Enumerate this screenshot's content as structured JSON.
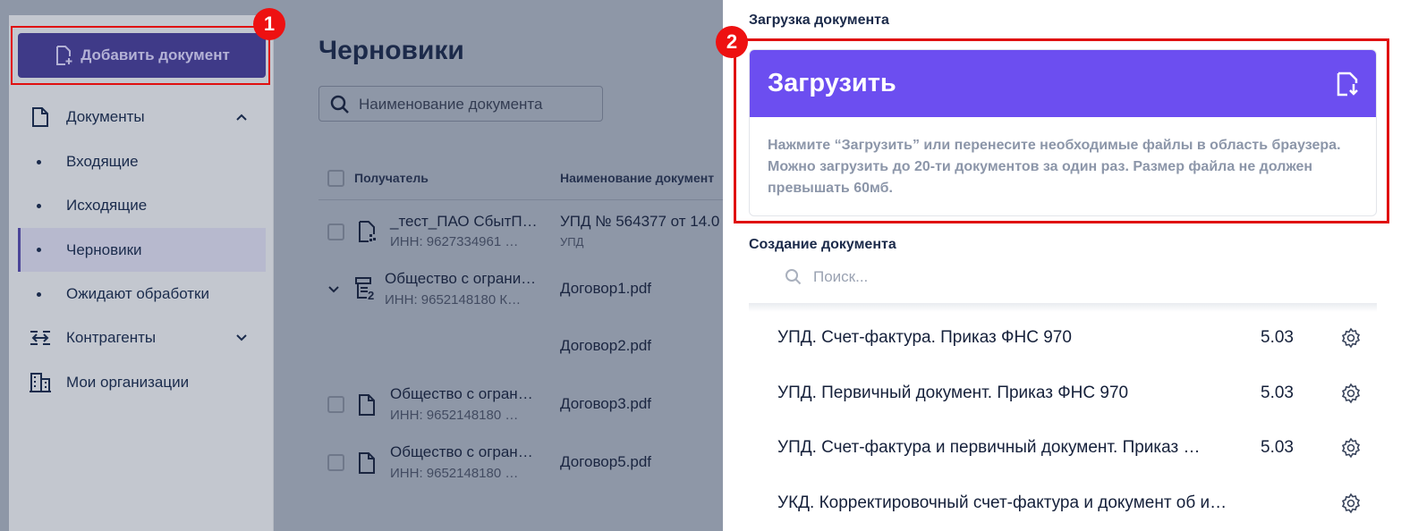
{
  "sidebar": {
    "add_button_label": "Добавить документ",
    "items": [
      {
        "label": "Документы"
      },
      {
        "label": "Входящие"
      },
      {
        "label": "Исходящие"
      },
      {
        "label": "Черновики"
      },
      {
        "label": "Ожидают обработки"
      },
      {
        "label": "Контрагенты"
      },
      {
        "label": "Мои организации"
      }
    ]
  },
  "markers": {
    "first": "1",
    "second": "2"
  },
  "main": {
    "title": "Черновики",
    "search_placeholder": "Наименование документа",
    "columns": {
      "recipient": "Получатель",
      "doc_name": "Наименование документ"
    },
    "rows": [
      {
        "recipient": "_тест_ПАО СбытП…",
        "inn": "ИНН: 9627334961 …",
        "doc": "УПД № 564377 от 14.0",
        "doc_type": "УПД"
      },
      {
        "recipient": "Общество с огрaни…",
        "inn": "ИНН: 9652148180 К…",
        "doc": "Договор1.pdf",
        "count": "2"
      },
      {
        "doc": "Договор2.pdf"
      },
      {
        "recipient": "Общество с огран…",
        "inn": "ИНН: 9652148180 …",
        "doc": "Договор3.pdf"
      },
      {
        "recipient": "Общество с огран…",
        "inn": "ИНН: 9652148180 …",
        "doc": "Договор5.pdf"
      }
    ]
  },
  "drawer": {
    "upload_section_title": "Загрузка документа",
    "upload_button_label": "Загрузить",
    "upload_hint": "Нажмите “Загрузить” или перенесите необходимые файлы в область браузера. Можно загрузить до 20-ти документов за один раз. Размер файла не должен превышать 60мб.",
    "create_section_title": "Создание документа",
    "search_placeholder": "Поиск...",
    "templates": [
      {
        "name": "УПД. Счет-фактура. Приказ ФНС 970",
        "version": "5.03"
      },
      {
        "name": "УПД. Первичный документ. Приказ ФНС 970",
        "version": "5.03"
      },
      {
        "name": "УПД. Счет-фактура и первичный документ. Приказ …",
        "version": "5.03"
      },
      {
        "name": "УКД. Корректировочный счет-фактура и документ об и…",
        "version": ""
      }
    ]
  },
  "colors": {
    "accent": "#6c4ef0",
    "highlight": "#e01010",
    "brand_dark": "#3f3a88"
  }
}
